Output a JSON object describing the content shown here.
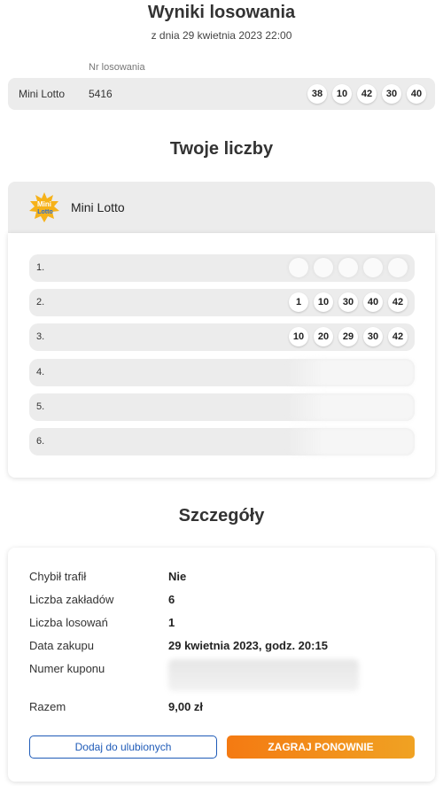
{
  "results": {
    "title": "Wyniki losowania",
    "subtitle": "z dnia 29 kwietnia 2023 22:00",
    "nr_label": "Nr losowania",
    "game": "Mini Lotto",
    "draw_number": "5416",
    "balls": [
      "38",
      "10",
      "42",
      "30",
      "40"
    ]
  },
  "your_numbers": {
    "title": "Twoje liczby",
    "game": "Mini Lotto",
    "logo_icon": "mini-lotto-logo",
    "logo_text_top": "Mini",
    "logo_text_bottom": "Lotto",
    "lines": [
      {
        "index": "1.",
        "balls": [
          "",
          "",
          "",
          "",
          ""
        ],
        "obscured": true
      },
      {
        "index": "2.",
        "balls": [
          "1",
          "10",
          "30",
          "40",
          "42"
        ],
        "obscured": false
      },
      {
        "index": "3.",
        "balls": [
          "10",
          "20",
          "29",
          "30",
          "42"
        ],
        "obscured": false
      },
      {
        "index": "4.",
        "balls": [],
        "obscured": true
      },
      {
        "index": "5.",
        "balls": [],
        "obscured": true
      },
      {
        "index": "6.",
        "balls": [],
        "obscured": true
      }
    ]
  },
  "details": {
    "title": "Szczegóły",
    "rows": [
      {
        "label": "Chybił trafił",
        "value": "Nie"
      },
      {
        "label": "Liczba zakładów",
        "value": "6"
      },
      {
        "label": "Liczba losowań",
        "value": "1"
      },
      {
        "label": "Data zakupu",
        "value": "29 kwietnia 2023, godz. 20:15"
      },
      {
        "label": "Numer kuponu",
        "value": ""
      },
      {
        "label": "Razem",
        "value": "9,00 zł"
      }
    ],
    "favorite_button": "Dodaj do ulubionych",
    "play_again_button": "ZAGRAJ PONOWNIE"
  }
}
